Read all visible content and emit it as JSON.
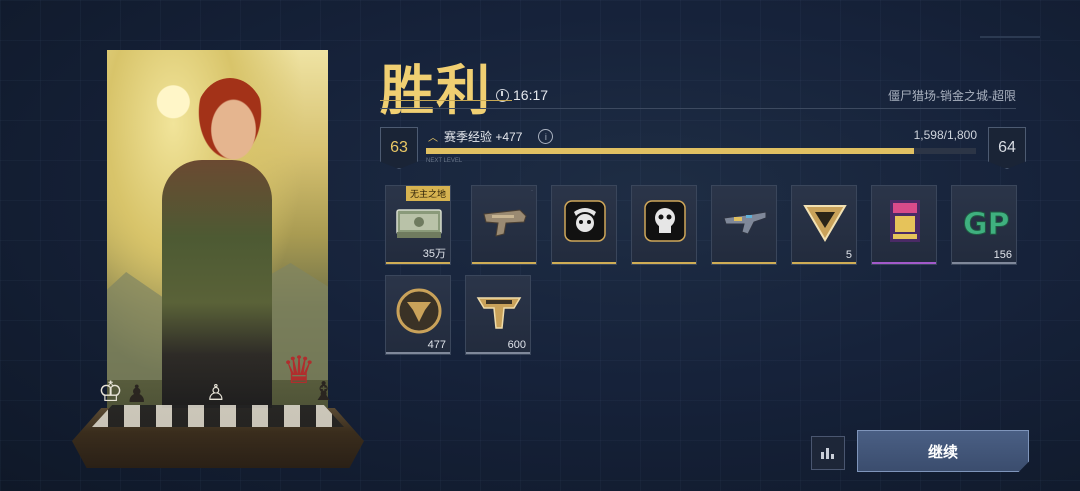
{
  "result": {
    "title": "胜利",
    "time": "16:17",
    "location": "僵尸猎场-销金之城-超限"
  },
  "level": {
    "current": "63",
    "next": "64",
    "xp_label": "赛季经验 +477",
    "xp_value": "1,598/1,800",
    "xp_fraction": 0.888,
    "xp_caption": "NEXT LEVEL"
  },
  "rewards": [
    {
      "name": "cash-bundle-icon",
      "count": "35万",
      "tag": "无主之地",
      "rarity_color": "#cfad55"
    },
    {
      "name": "pistol-icon",
      "count": "",
      "tag": "",
      "rarity_color": "#cfad55"
    },
    {
      "name": "ox-skull-emblem-icon",
      "count": "",
      "tag": "",
      "rarity_color": "#cfad55"
    },
    {
      "name": "skull-emblem-icon",
      "count": "",
      "tag": "",
      "rarity_color": "#cfad55"
    },
    {
      "name": "rifle-icon",
      "count": "",
      "tag": "",
      "rarity_color": "#cfad55"
    },
    {
      "name": "triangle-token-icon",
      "count": "5",
      "tag": "",
      "rarity_color": "#cfad55"
    },
    {
      "name": "poster-icon",
      "count": "",
      "tag": "",
      "rarity_color": "#a25acb"
    },
    {
      "name": "gp-currency-icon",
      "count": "156",
      "tag": "",
      "rarity_color": "#7f889a"
    },
    {
      "name": "rank-coin-icon",
      "count": "477",
      "tag": "",
      "rarity_color": "#7f889a"
    },
    {
      "name": "rank-emblem-icon",
      "count": "600",
      "tag": "",
      "rarity_color": "#7f889a"
    }
  ],
  "buttons": {
    "continue": "继续",
    "stats_icon": "bar-chart-icon"
  }
}
